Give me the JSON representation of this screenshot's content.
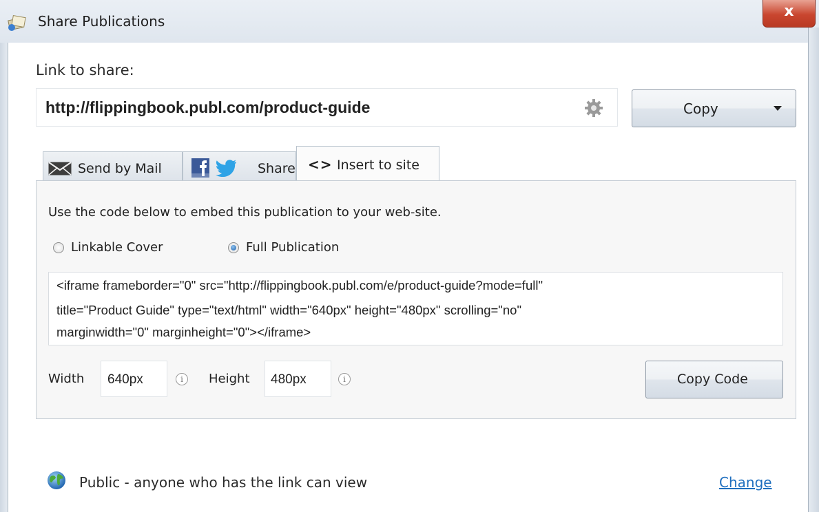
{
  "window": {
    "title": "Share Publications",
    "close_glyph": "x"
  },
  "link": {
    "label": "Link to share:",
    "url": "http://flippingbook.publ.com/product-guide",
    "settings_icon": "gear-icon",
    "copy_label": "Copy"
  },
  "tabs": [
    {
      "label": "Send by Mail",
      "icon": "envelope-icon",
      "selected": false
    },
    {
      "label": "Share",
      "icon": "facebook-twitter-icons",
      "selected": false
    },
    {
      "label": "Insert to site",
      "icon": "code-brackets-icon",
      "selected": true
    }
  ],
  "embed": {
    "instruction": "Use the code below to embed this publication to your web-site.",
    "options": [
      {
        "label": "Linkable Cover",
        "selected": false
      },
      {
        "label": "Full Publication",
        "selected": true
      }
    ],
    "code_lines": [
      "<iframe frameborder=\"0\" src=\"http://flippingbook.publ.com/e/product-guide?mode=full\"",
      "title=\"Product Guide\" type=\"text/html\" width=\"640px\" height=\"480px\"  scrolling=\"no\"",
      "marginwidth=\"0\" marginheight=\"0\"></iframe>"
    ],
    "width_label": "Width",
    "width_value": "640px",
    "height_label": "Height",
    "height_value": "480px",
    "copy_code_label": "Copy Code"
  },
  "access": {
    "text": "Public - anyone who has the link can view",
    "change_label": "Change"
  },
  "colors": {
    "link": "#1f6fbf",
    "close": "#c9462f",
    "facebook": "#3b5998",
    "twitter": "#2fa3e6"
  }
}
